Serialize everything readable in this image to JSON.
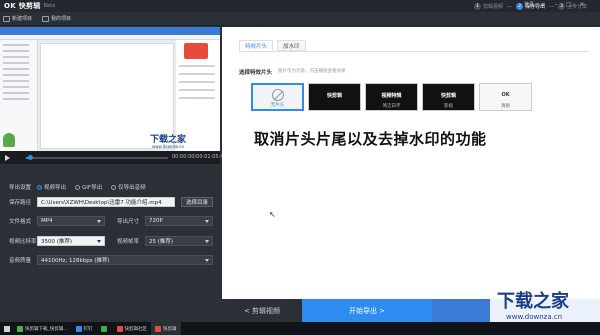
{
  "app": {
    "logo": "OK 快剪辑",
    "beta": "Beta"
  },
  "steps": [
    {
      "num": "1",
      "label": "剪辑视频",
      "active": false
    },
    {
      "num": "2",
      "label": "保存导出",
      "active": true
    },
    {
      "num": "3",
      "label": "上传分享",
      "active": false
    }
  ],
  "top_right": {
    "login": "登录"
  },
  "toolbar": {
    "new_project": "新建项目",
    "my_projects": "我的项目"
  },
  "preview": {
    "watermark": "下载之家",
    "watermark_sub": "www.downza.cn"
  },
  "player": {
    "time": "00:00:00/00:01:05:44",
    "progress": 0.03
  },
  "export": {
    "title": "导出设置",
    "modes": [
      {
        "label": "视频导出",
        "selected": true
      },
      {
        "label": "GIF导出",
        "selected": false
      },
      {
        "label": "仅导出音频",
        "selected": false
      }
    ],
    "save_path_label": "保存路径",
    "save_path_value": "C:\\Users\\XZWH\\Desktop\\迅雷7 功能介绍.mp4",
    "choose_dir_label": "选择目录",
    "format_label": "文件格式",
    "format_value": "MP4",
    "size_label": "导出尺寸",
    "size_value": "720P",
    "bitrate_label": "视频比特率",
    "bitrate_value": "3500 (推荐)",
    "framerate_label": "视频帧率",
    "framerate_value": "25 (推荐)",
    "audio_label": "音频质量",
    "audio_value": "44100Hz, 128kbps (推荐)"
  },
  "panel": {
    "tabs": [
      {
        "label": "特效片头",
        "active": true
      },
      {
        "label": "加水印",
        "active": false
      }
    ],
    "section_title": "选择特效片头",
    "section_hint": "图片仅为示意，点击播放查看效果",
    "thumbs": [
      {
        "title": "",
        "caption": "无片头",
        "selected": true
      },
      {
        "title": "快剪辑",
        "caption": "",
        "selected": false
      },
      {
        "title": "视频特辑",
        "caption": "简洁白字",
        "selected": false
      },
      {
        "title": "快剪辑",
        "caption": "影视",
        "selected": false
      },
      {
        "title": "",
        "caption": "清爽",
        "selected": false
      }
    ],
    "caption_overlay": "取消片头片尾以及去掉水印的功能"
  },
  "actions": {
    "prev": "< 剪辑视频",
    "next": "开始导出 >"
  },
  "watermark": {
    "main": "下载之家",
    "url": "www.downza.cn"
  },
  "taskbar": {
    "items": [
      {
        "label": "快剪辑下载_快剪辑..."
      },
      {
        "label": "钉钉"
      },
      {
        "label": ""
      },
      {
        "label": "快剪辑社区"
      },
      {
        "label": "快剪辑"
      }
    ]
  },
  "colors": {
    "accent": "#2f8cf0",
    "dark_bg": "#2b2f36",
    "panel_bg": "#ffffff"
  }
}
